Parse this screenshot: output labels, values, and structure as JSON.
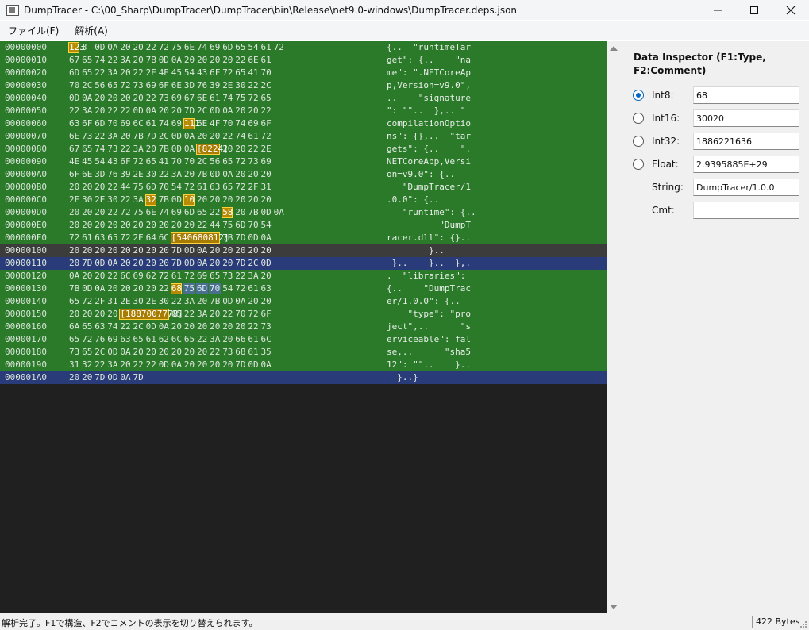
{
  "window": {
    "title": "DumpTracer - C:\\00_Sharp\\DumpTracer\\DumpTracer\\bin\\Release\\net9.0-windows\\DumpTracer.deps.json"
  },
  "menu": {
    "items": [
      "ファイル(F)",
      "解析(A)"
    ]
  },
  "hex": {
    "rows": [
      {
        "addr": "00000000",
        "bytes": [
          "",
          "3",
          "0D",
          "0A",
          "20",
          "20",
          "22",
          "72",
          "75",
          "6E",
          "74",
          "69",
          "6D",
          "65",
          "54",
          "61",
          "72"
        ],
        "ascii": "{..  \"runtimeTar",
        "style": "norm"
      },
      {
        "addr": "00000010",
        "bytes": [
          "67",
          "65",
          "74",
          "22",
          "3A",
          "20",
          "7B",
          "0D",
          "0A",
          "20",
          "20",
          "20",
          "20",
          "22",
          "6E",
          "61"
        ],
        "ascii": "get\": {..    \"na",
        "style": "norm"
      },
      {
        "addr": "00000020",
        "bytes": [
          "6D",
          "65",
          "22",
          "3A",
          "20",
          "22",
          "2E",
          "4E",
          "45",
          "54",
          "43",
          "6F",
          "72",
          "65",
          "41",
          "70"
        ],
        "ascii": "me\": \".NETCoreAp",
        "style": "norm"
      },
      {
        "addr": "00000030",
        "bytes": [
          "70",
          "2C",
          "56",
          "65",
          "72",
          "73",
          "69",
          "6F",
          "6E",
          "3D",
          "76",
          "39",
          "2E",
          "30",
          "22",
          "2C"
        ],
        "ascii": "p,Version=v9.0\",",
        "style": "norm"
      },
      {
        "addr": "00000040",
        "bytes": [
          "0D",
          "0A",
          "20",
          "20",
          "20",
          "20",
          "22",
          "73",
          "69",
          "67",
          "6E",
          "61",
          "74",
          "75",
          "72",
          "65"
        ],
        "ascii": "..    \"signature",
        "style": "norm"
      },
      {
        "addr": "00000050",
        "bytes": [
          "22",
          "3A",
          "20",
          "22",
          "22",
          "0D",
          "0A",
          "20",
          "20",
          "7D",
          "2C",
          "0D",
          "0A",
          "20",
          "20",
          "22"
        ],
        "ascii": "\": \"\"..  },.. \"",
        "style": "norm"
      },
      {
        "addr": "00000060",
        "bytes": [
          "63",
          "6F",
          "6D",
          "70",
          "69",
          "6C",
          "61",
          "74",
          "69",
          "",
          "6E",
          "4F",
          "70",
          "74",
          "69",
          "6F"
        ],
        "ascii": "compilationOptio",
        "style": "norm"
      },
      {
        "addr": "00000070",
        "bytes": [
          "6E",
          "73",
          "22",
          "3A",
          "20",
          "7B",
          "7D",
          "2C",
          "0D",
          "0A",
          "20",
          "20",
          "22",
          "74",
          "61",
          "72"
        ],
        "ascii": "ns\": {},..  \"tar",
        "style": "norm"
      },
      {
        "addr": "00000080",
        "bytes": [
          "67",
          "65",
          "74",
          "73",
          "22",
          "3A",
          "20",
          "7B",
          "0D",
          "0A",
          "",
          "",
          "20",
          "20",
          "22",
          "2E"
        ],
        "ascii": "gets\": {..    \".",
        "style": "norm"
      },
      {
        "addr": "00000090",
        "bytes": [
          "4E",
          "45",
          "54",
          "43",
          "6F",
          "72",
          "65",
          "41",
          "70",
          "70",
          "2C",
          "56",
          "65",
          "72",
          "73",
          "69"
        ],
        "ascii": "NETCoreApp,Versi",
        "style": "norm"
      },
      {
        "addr": "000000A0",
        "bytes": [
          "6F",
          "6E",
          "3D",
          "76",
          "39",
          "2E",
          "30",
          "22",
          "3A",
          "20",
          "7B",
          "0D",
          "0A",
          "20",
          "20",
          "20"
        ],
        "ascii": "on=v9.0\": {..",
        "style": "norm"
      },
      {
        "addr": "000000B0",
        "bytes": [
          "20",
          "20",
          "20",
          "22",
          "44",
          "75",
          "6D",
          "70",
          "54",
          "72",
          "61",
          "63",
          "65",
          "72",
          "2F",
          "31"
        ],
        "ascii": "   \"DumpTracer/1",
        "style": "norm"
      },
      {
        "addr": "000000C0",
        "bytes": [
          "2E",
          "30",
          "2E",
          "30",
          "22",
          "3A",
          "",
          "7B",
          "0D",
          "",
          "20",
          "20",
          "20",
          "20",
          "20",
          "20"
        ],
        "ascii": ".0.0\": {..",
        "style": "norm"
      },
      {
        "addr": "000000D0",
        "bytes": [
          "20",
          "20",
          "20",
          "22",
          "72",
          "75",
          "6E",
          "74",
          "69",
          "6D",
          "65",
          "22",
          "",
          "20",
          "7B",
          "0D",
          "0A"
        ],
        "ascii": "   \"runtime\": {..",
        "style": "norm"
      },
      {
        "addr": "000000E0",
        "bytes": [
          "20",
          "20",
          "20",
          "20",
          "20",
          "20",
          "20",
          "20",
          "20",
          "20",
          "22",
          "44",
          "75",
          "6D",
          "70",
          "54"
        ],
        "ascii": "          \"DumpT",
        "style": "norm"
      },
      {
        "addr": "000000F0",
        "bytes": [
          "72",
          "61",
          "63",
          "65",
          "72",
          "2E",
          "64",
          "6C",
          "",
          "",
          "",
          "",
          "7B",
          "7D",
          "0D",
          "0A"
        ],
        "ascii": "racer.dll\": {}..",
        "style": "norm"
      },
      {
        "addr": "00000100",
        "bytes": [
          "20",
          "20",
          "20",
          "20",
          "20",
          "20",
          "20",
          "20",
          "7D",
          "0D",
          "0A",
          "20",
          "20",
          "20",
          "20",
          "20"
        ],
        "ascii": "        }..",
        "style": "gray"
      },
      {
        "addr": "00000110",
        "bytes": [
          "20",
          "7D",
          "0D",
          "0A",
          "20",
          "20",
          "20",
          "20",
          "7D",
          "0D",
          "0A",
          "20",
          "20",
          "7D",
          "2C",
          "0D"
        ],
        "ascii": " }..    }..  },.",
        "style": "sel"
      },
      {
        "addr": "00000120",
        "bytes": [
          "0A",
          "20",
          "20",
          "22",
          "6C",
          "69",
          "62",
          "72",
          "61",
          "72",
          "69",
          "65",
          "73",
          "22",
          "3A",
          "20"
        ],
        "ascii": ".  \"libraries\":",
        "style": "norm"
      },
      {
        "addr": "00000130",
        "bytes": [
          "7B",
          "0D",
          "0A",
          "20",
          "20",
          "20",
          "20",
          "22",
          "",
          "",
          "",
          "",
          "54",
          "72",
          "61",
          "63"
        ],
        "ascii": "{..    \"DumpTrac",
        "style": "norm"
      },
      {
        "addr": "00000140",
        "bytes": [
          "65",
          "72",
          "2F",
          "31",
          "2E",
          "30",
          "2E",
          "30",
          "22",
          "3A",
          "20",
          "7B",
          "0D",
          "0A",
          "20",
          "20"
        ],
        "ascii": "er/1.0.0\": {..",
        "style": "norm"
      },
      {
        "addr": "00000150",
        "bytes": [
          "20",
          "20",
          "20",
          "20",
          "",
          "",
          "",
          "",
          "65",
          "22",
          "3A",
          "20",
          "22",
          "70",
          "72",
          "6F"
        ],
        "ascii": "    \"type\": \"pro",
        "style": "norm"
      },
      {
        "addr": "00000160",
        "bytes": [
          "6A",
          "65",
          "63",
          "74",
          "22",
          "2C",
          "0D",
          "0A",
          "20",
          "20",
          "20",
          "20",
          "20",
          "20",
          "22",
          "73"
        ],
        "ascii": "ject\",..      \"s",
        "style": "norm"
      },
      {
        "addr": "00000170",
        "bytes": [
          "65",
          "72",
          "76",
          "69",
          "63",
          "65",
          "61",
          "62",
          "6C",
          "65",
          "22",
          "3A",
          "20",
          "66",
          "61",
          "6C"
        ],
        "ascii": "erviceable\": fal",
        "style": "norm"
      },
      {
        "addr": "00000180",
        "bytes": [
          "73",
          "65",
          "2C",
          "0D",
          "0A",
          "20",
          "20",
          "20",
          "20",
          "20",
          "20",
          "22",
          "73",
          "68",
          "61",
          "35"
        ],
        "ascii": "se,..      \"sha5",
        "style": "norm"
      },
      {
        "addr": "00000190",
        "bytes": [
          "31",
          "32",
          "22",
          "3A",
          "20",
          "22",
          "22",
          "0D",
          "0A",
          "20",
          "20",
          "20",
          "20",
          "7D",
          "0D",
          "0A"
        ],
        "ascii": "12\": \"\"..    }..",
        "style": "norm"
      },
      {
        "addr": "000001A0",
        "bytes": [
          "20",
          "20",
          "7D",
          "0D",
          "0A",
          "7D"
        ],
        "ascii": "  }..}",
        "style": "sel"
      }
    ],
    "marks": [
      {
        "row": 0,
        "col": 0,
        "span": 1,
        "text": "123"
      },
      {
        "row": 6,
        "col": 9,
        "span": 1,
        "text": "111"
      },
      {
        "row": 8,
        "col": 10,
        "span": 2,
        "text": "[8224]"
      },
      {
        "row": 12,
        "col": 6,
        "span": 1,
        "text": "32"
      },
      {
        "row": 12,
        "col": 9,
        "span": 1,
        "text": "10"
      },
      {
        "row": 13,
        "col": 12,
        "span": 1,
        "text": "58"
      },
      {
        "row": 15,
        "col": 8,
        "span": 4,
        "text": "[540680812]"
      },
      {
        "row": 19,
        "col": 8,
        "span": 1,
        "text": "68"
      },
      {
        "row": 21,
        "col": 4,
        "span": 4,
        "text": "[1887007778]"
      }
    ],
    "blue_marks": [
      {
        "row": 19,
        "col": 9,
        "text": "75"
      },
      {
        "row": 19,
        "col": 10,
        "text": "6D"
      },
      {
        "row": 19,
        "col": 11,
        "text": "70"
      }
    ]
  },
  "inspector": {
    "title": "Data Inspector (F1:Type, F2:Comment)",
    "fields": [
      {
        "label": "Int8:",
        "value": "68",
        "radio": true,
        "checked": true
      },
      {
        "label": "Int16:",
        "value": "30020",
        "radio": true,
        "checked": false
      },
      {
        "label": "Int32:",
        "value": "1886221636",
        "radio": true,
        "checked": false
      },
      {
        "label": "Float:",
        "value": "2.9395885E+29",
        "radio": true,
        "checked": false
      },
      {
        "label": "String:",
        "value": "DumpTracer/1.0.0",
        "radio": false,
        "checked": false
      },
      {
        "label": "Cmt:",
        "value": "",
        "radio": false,
        "checked": false
      }
    ]
  },
  "status": {
    "message": "解析完了。F1で構造、F2でコメントの表示を切り替えられます。",
    "size": "422 Bytes"
  }
}
